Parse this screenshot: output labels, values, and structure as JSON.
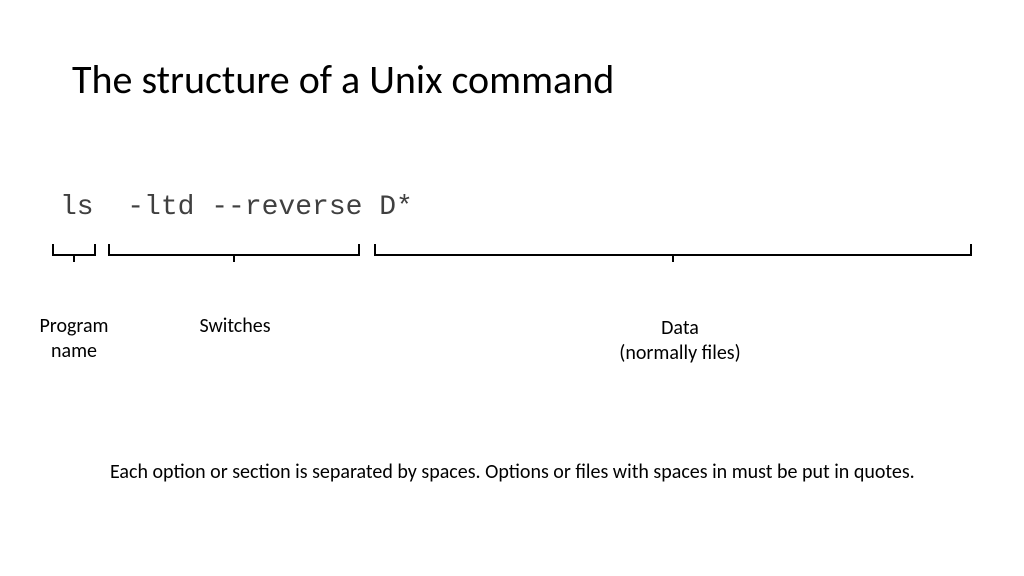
{
  "title": "The structure of a Unix command",
  "command": "ls  -ltd --reverse D*",
  "labels": {
    "program": "Program\nname",
    "switches": "Switches",
    "data": "Data\n(normally files)"
  },
  "footnote": "Each option or section is separated by spaces.  Options or files with spaces in must be put in quotes."
}
